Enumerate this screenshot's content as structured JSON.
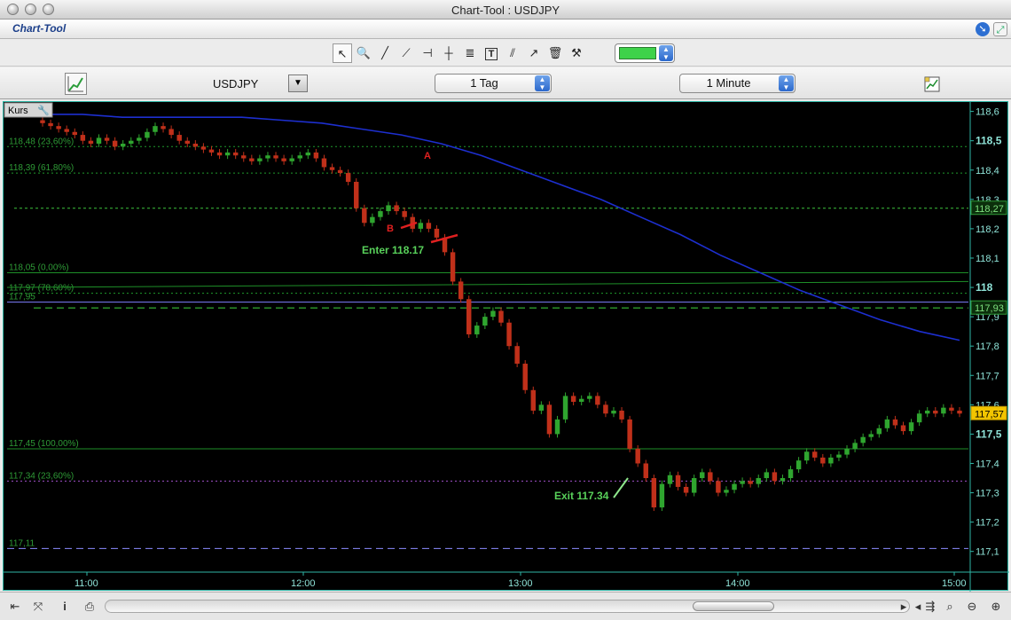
{
  "window": {
    "title": "Chart-Tool : USDJPY"
  },
  "app_header": {
    "app_name": "Chart-Tool"
  },
  "toolbar": {
    "tools": [
      {
        "name": "pointer-tool",
        "icon": "arrow-cursor-icon",
        "glyph": "↖",
        "active": true
      },
      {
        "name": "zoom-tool",
        "icon": "magnifier-plus-icon",
        "glyph": "🔍"
      },
      {
        "name": "line-tool",
        "icon": "trend-line-icon",
        "glyph": "╱"
      },
      {
        "name": "extended-line-tool",
        "icon": "extended-line-icon",
        "glyph": "⟋"
      },
      {
        "name": "horizontal-line-tool",
        "icon": "horizontal-line-icon",
        "glyph": "⊣"
      },
      {
        "name": "vertical-line-tool",
        "icon": "vertical-line-icon",
        "glyph": "┼"
      },
      {
        "name": "fibonacci-tool",
        "icon": "fibonacci-icon",
        "glyph": "≣"
      },
      {
        "name": "text-tool",
        "icon": "text-tool-icon",
        "glyph": "T"
      },
      {
        "name": "parallel-lines-tool",
        "icon": "parallel-lines-icon",
        "glyph": "⫽"
      },
      {
        "name": "arrow-tool",
        "icon": "arrow-line-icon",
        "glyph": "↗"
      },
      {
        "name": "delete-tool",
        "icon": "trash-icon",
        "glyph": "🗑"
      },
      {
        "name": "properties-tool",
        "icon": "tools-icon",
        "glyph": "⚒"
      }
    ],
    "line_color": "#3ed24a"
  },
  "controls": {
    "symbol": "USDJPY",
    "period": "1 Tag",
    "interval": "1 Minute"
  },
  "chart_data": {
    "type": "candlestick",
    "indicator_label": "Kurs",
    "x_ticks": [
      "11:00",
      "12:00",
      "13:00",
      "14:00",
      "15:00"
    ],
    "y_ticks": [
      "118,6",
      "118,5",
      "118,4",
      "118,3",
      "118,2",
      "118,1",
      "118",
      "117,9",
      "117,8",
      "117,7",
      "117,6",
      "117,5",
      "117,4",
      "117,3",
      "117,2",
      "117,1"
    ],
    "ylim": [
      117.09,
      118.62
    ],
    "price_labels": [
      {
        "text": "118,27",
        "value": 118.27,
        "style": "green-box"
      },
      {
        "text": "117,93",
        "value": 117.93,
        "style": "green-box"
      },
      {
        "text": "117,57",
        "value": 117.57,
        "style": "yellow-box"
      }
    ],
    "fib_levels": [
      {
        "label": "118,48 (23,60%)",
        "value": 118.48,
        "style": "dotted-green"
      },
      {
        "label": "118,39 (61,80%)",
        "value": 118.39,
        "style": "dotted-green"
      },
      {
        "label": "118,05 (0,00%)",
        "value": 118.05,
        "style": "solid-green"
      },
      {
        "label": "117,97 (78,60%)",
        "value": 117.98,
        "style": "dotted-green"
      },
      {
        "label": "117,95",
        "value": 117.95,
        "style": "solid-blue"
      },
      {
        "label": "117,45 (100,00%)",
        "value": 117.45,
        "style": "solid-green"
      },
      {
        "label": "117,34 (23,60%)",
        "value": 117.34,
        "style": "dotted-purple"
      },
      {
        "label": "117,11",
        "value": 117.11,
        "style": "dashed-blue"
      }
    ],
    "annotations": [
      {
        "text": "A",
        "color": "#e02020"
      },
      {
        "text": "B",
        "color": "#e02020"
      },
      {
        "text": "Enter 118.17",
        "color": "#58d15a"
      },
      {
        "text": "Exit 117.34",
        "color": "#58d15a"
      }
    ],
    "series_close": [
      118.56,
      118.55,
      118.54,
      118.53,
      118.52,
      118.5,
      118.49,
      118.51,
      118.5,
      118.48,
      118.49,
      118.5,
      118.51,
      118.53,
      118.55,
      118.54,
      118.52,
      118.5,
      118.49,
      118.48,
      118.47,
      118.46,
      118.45,
      118.46,
      118.45,
      118.44,
      118.43,
      118.44,
      118.45,
      118.44,
      118.43,
      118.44,
      118.45,
      118.46,
      118.44,
      118.41,
      118.4,
      118.39,
      118.36,
      118.27,
      118.22,
      118.24,
      118.26,
      118.28,
      118.26,
      118.24,
      118.2,
      118.22,
      118.2,
      118.17,
      118.12,
      118.02,
      117.96,
      117.84,
      117.87,
      117.9,
      117.92,
      117.88,
      117.8,
      117.74,
      117.65,
      117.58,
      117.6,
      117.5,
      117.55,
      117.63,
      117.61,
      117.62,
      117.63,
      117.6,
      117.57,
      117.58,
      117.55,
      117.45,
      117.4,
      117.35,
      117.25,
      117.33,
      117.36,
      117.32,
      117.3,
      117.35,
      117.37,
      117.34,
      117.3,
      117.31,
      117.33,
      117.34,
      117.33,
      117.35,
      117.37,
      117.34,
      117.35,
      117.38,
      117.41,
      117.44,
      117.42,
      117.4,
      117.42,
      117.43,
      117.45,
      117.47,
      117.49,
      117.5,
      117.52,
      117.55,
      117.53,
      117.51,
      117.54,
      117.57,
      117.58,
      117.57,
      117.59,
      117.58,
      117.57
    ],
    "moving_average": [
      118.59,
      118.59,
      118.58,
      118.58,
      118.58,
      118.58,
      118.57,
      118.56,
      118.54,
      118.52,
      118.49,
      118.45,
      118.4,
      118.35,
      118.3,
      118.24,
      118.18,
      118.11,
      118.05,
      117.99,
      117.94,
      117.89,
      117.85,
      117.82
    ],
    "legend_position": "top-left",
    "grid": false
  },
  "bottom": {
    "scrollbar": "horizontal"
  }
}
